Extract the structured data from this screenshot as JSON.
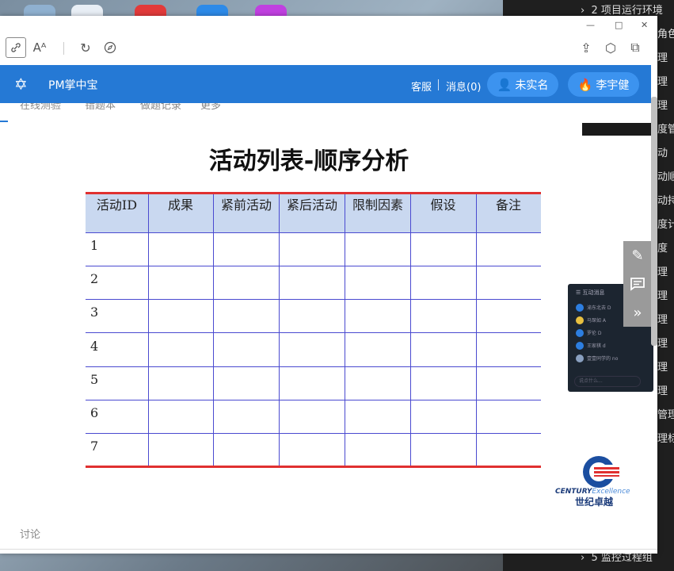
{
  "right_panel": {
    "top_item": "2 项目运行环境",
    "bottom_item": "5 监控过程组",
    "fragments": [
      "角色",
      "理",
      "理",
      "理",
      "度管",
      "动",
      "动顺",
      "动持",
      "度计",
      "度",
      "理",
      "理",
      "理",
      "理",
      "理",
      "理",
      "管理",
      "理标"
    ]
  },
  "browser": {
    "toolbar_icons": [
      "link-icon",
      "font-size-icon",
      "refresh-icon",
      "compass-icon",
      "share-icon",
      "cube-icon",
      "extension-icon"
    ],
    "window_controls": [
      "—",
      "□",
      "✕"
    ]
  },
  "header": {
    "app_title": "PM掌中宝",
    "service": "客服",
    "messages": "消息(0)",
    "user_status": "未实名",
    "user_name": "李宇健",
    "colors": {
      "bar": "#2579d5",
      "pill": "#3c93ef"
    }
  },
  "tabs": [
    "在线测验",
    "错题本",
    "做题记录",
    "更多"
  ],
  "slide": {
    "title": "活动列表-顺序分析",
    "columns": [
      "活动ID",
      "成果",
      "紧前活动",
      "紧后活动",
      "限制因素",
      "假设",
      "备注"
    ],
    "rows": [
      "1",
      "2",
      "3",
      "4",
      "5",
      "6",
      "7"
    ]
  },
  "company": {
    "name_en": "CENTURY",
    "name_en2": "Excellence",
    "name_cn": "世纪卓越"
  },
  "chat": {
    "title": "互动消息",
    "entries": [
      "渝东北去 D",
      "马琛如 A",
      "罗伦 D",
      "王家棋 d",
      "壹壹同学的 no"
    ],
    "input_placeholder": "说点什么..."
  },
  "footer": {
    "discuss": "讨论"
  }
}
